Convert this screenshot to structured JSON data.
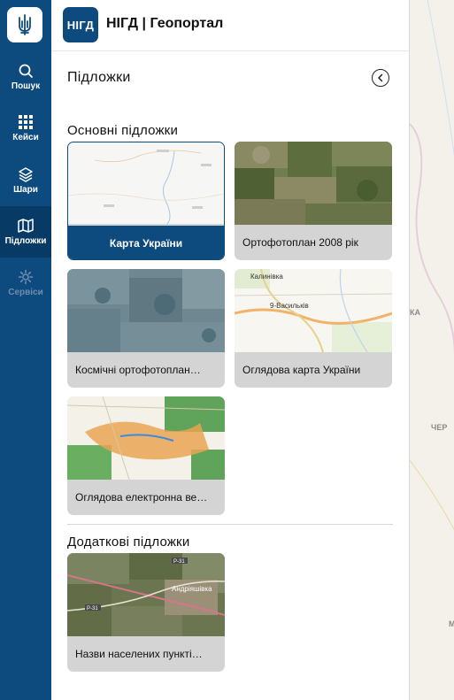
{
  "app": {
    "badge": "НІГД",
    "title": "НІГД | Геопортал"
  },
  "rail": {
    "items": [
      {
        "label": "Пошук",
        "icon": "search-icon",
        "active": false,
        "disabled": false
      },
      {
        "label": "Кейси",
        "icon": "grid-icon",
        "active": false,
        "disabled": false
      },
      {
        "label": "Шари",
        "icon": "layers-icon",
        "active": false,
        "disabled": false
      },
      {
        "label": "Підложки",
        "icon": "map-icon",
        "active": true,
        "disabled": false
      },
      {
        "label": "Сервіси",
        "icon": "gear-icon",
        "active": false,
        "disabled": true
      }
    ]
  },
  "panel": {
    "title": "Підложки",
    "main_section": "Основні підложки",
    "extra_section": "Додаткові підложки",
    "main_cards": [
      {
        "label": "Карта України",
        "selected": true
      },
      {
        "label": "Ортофотоплан 2008 рік",
        "selected": false
      },
      {
        "label": "Космічні ортофотоплан…",
        "selected": false
      },
      {
        "label": "Оглядова карта України",
        "selected": false
      },
      {
        "label": "Оглядова електронна ве…",
        "selected": false
      }
    ],
    "extra_cards": [
      {
        "label": "Назви населених пункті…",
        "selected": false
      }
    ]
  },
  "thumb_text": {
    "overview_1": "Калинівка",
    "overview_2": "9-Васильків",
    "road_1": "Р-31",
    "road_2": "Р-31",
    "road_3": "Андріяшівка"
  },
  "map": {
    "labels": [
      "КА",
      "ЧЕР",
      "М"
    ]
  },
  "colors": {
    "brand": "#0d4a7e",
    "active_rail": "#083a66",
    "card_bg": "#d4d4d4"
  }
}
